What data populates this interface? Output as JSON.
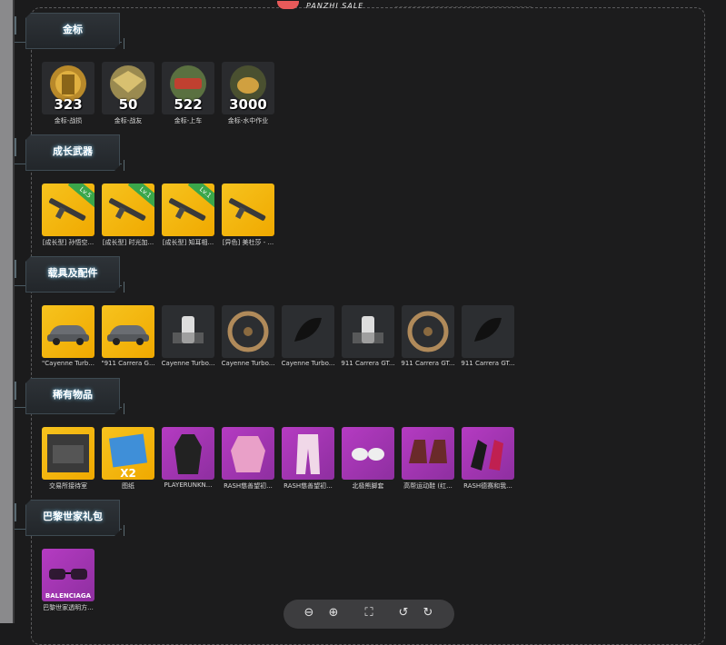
{
  "header": {
    "brand": "PANZHI SALE"
  },
  "sections": [
    {
      "title": "金标",
      "items": [
        {
          "caption": "金标-战损",
          "count": "323",
          "style": "medal",
          "icon": "soldier-medal-icon"
        },
        {
          "caption": "金标-战友",
          "count": "50",
          "style": "medal",
          "icon": "eagle-medal-icon"
        },
        {
          "caption": "金标-上车",
          "count": "522",
          "style": "medal",
          "icon": "car-medal-icon"
        },
        {
          "caption": "金标-水中作业",
          "count": "3000",
          "style": "medal",
          "icon": "seal-medal-icon"
        }
      ]
    },
    {
      "title": "成长武器",
      "items": [
        {
          "caption": "[成长型] 孙悟空...",
          "badge": "Lv.5",
          "style": "gold",
          "icon": "rifle-icon"
        },
        {
          "caption": "[成长型] 时光加...",
          "badge": "Lv.1",
          "style": "gold",
          "icon": "rifle-icon"
        },
        {
          "caption": "[成长型] 知耳相...",
          "badge": "Lv.1",
          "style": "gold",
          "icon": "rifle-icon"
        },
        {
          "caption": "[异色] 美杜莎 - ...",
          "style": "gold",
          "icon": "rifle-icon"
        }
      ]
    },
    {
      "title": "载具及配件",
      "items": [
        {
          "caption": "\"Cayenne Turb...",
          "style": "gold",
          "icon": "car-icon"
        },
        {
          "caption": "\"911 Carrera G...",
          "style": "gold",
          "icon": "car-icon"
        },
        {
          "caption": "Cayenne Turbo...",
          "style": "dark",
          "icon": "paint-can-icon"
        },
        {
          "caption": "Cayenne Turbo...",
          "style": "dark",
          "icon": "wheel-icon"
        },
        {
          "caption": "Cayenne Turbo...",
          "style": "dark",
          "icon": "mirror-icon"
        },
        {
          "caption": "911 Carrera GT...",
          "style": "dark",
          "icon": "paint-can-icon"
        },
        {
          "caption": "911 Carrera GT...",
          "style": "dark",
          "icon": "wheel-icon"
        },
        {
          "caption": "911 Carrera GT...",
          "style": "dark",
          "icon": "mirror-icon"
        }
      ]
    },
    {
      "title": "稀有物品",
      "items": [
        {
          "caption": "交易所接待室",
          "style": "gold",
          "icon": "room-icon"
        },
        {
          "caption": "图纸",
          "count": "X2",
          "style": "gold",
          "icon": "blueprint-icon"
        },
        {
          "caption": "PLAYERUNKN...",
          "style": "purple",
          "icon": "coat-icon"
        },
        {
          "caption": "RASH慈善望初...",
          "style": "purple",
          "icon": "hoodie-icon"
        },
        {
          "caption": "RASH慈善望初...",
          "style": "purple",
          "icon": "pants-icon"
        },
        {
          "caption": "北极熊脚套",
          "style": "purple",
          "icon": "paws-icon"
        },
        {
          "caption": "高帮运动鞋 (红...",
          "style": "purple",
          "icon": "boots-icon"
        },
        {
          "caption": "RASH德赛和我...",
          "style": "purple",
          "icon": "gloves-icon"
        }
      ]
    },
    {
      "title": "巴黎世家礼包",
      "items": [
        {
          "caption": "巴黎世家透明方...",
          "brand": "BALENCIAGA",
          "style": "purple",
          "icon": "sunglasses-icon"
        }
      ]
    }
  ],
  "toolbar": {
    "buttons": [
      {
        "name": "zoom-out-button",
        "icon": "zoom-out-icon",
        "glyph": "⊖"
      },
      {
        "name": "zoom-in-button",
        "icon": "zoom-in-icon",
        "glyph": "⊕"
      },
      {
        "name": "fit-screen-button",
        "icon": "fullscreen-icon",
        "glyph": "⛶"
      },
      {
        "name": "rotate-left-button",
        "icon": "rotate-left-icon",
        "glyph": "↺"
      },
      {
        "name": "rotate-right-button",
        "icon": "rotate-right-icon",
        "glyph": "↻"
      }
    ]
  }
}
